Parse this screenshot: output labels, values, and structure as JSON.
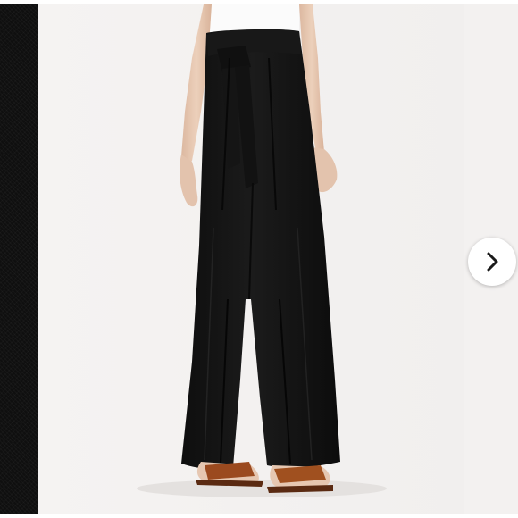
{
  "carousel": {
    "slides": [
      {
        "name": "black-fabric-closeup"
      },
      {
        "name": "black-wide-leg-tie-waist-pants"
      },
      {
        "name": "next-product-image"
      }
    ],
    "current_index": 1,
    "next_control": {
      "icon": "chevron-right-icon"
    }
  },
  "colors": {
    "pants": "#141414",
    "background": "#f4f2f1",
    "top": "#fafafa",
    "skin": "#e8c9b2",
    "sandals": "#9b4a1f"
  }
}
